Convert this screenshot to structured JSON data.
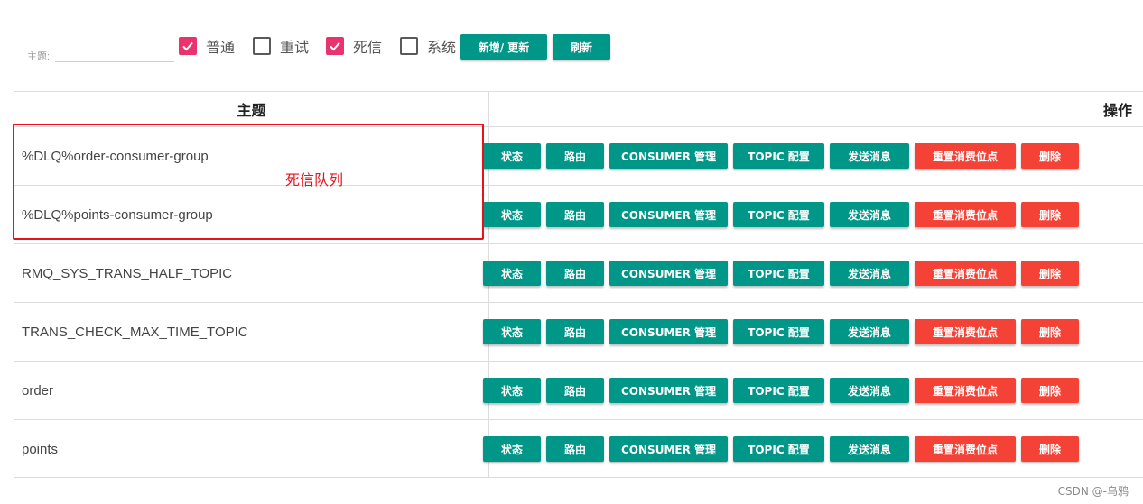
{
  "filter": {
    "label": "主题:",
    "input_value": "",
    "checkboxes": [
      {
        "label": "普通",
        "checked": true
      },
      {
        "label": "重试",
        "checked": false
      },
      {
        "label": "死信",
        "checked": true
      },
      {
        "label": "系统",
        "checked": false
      }
    ],
    "add_update_label": "新增/ 更新",
    "refresh_label": "刷新"
  },
  "table": {
    "header_topic": "主题",
    "header_ops": "操作",
    "rows": [
      {
        "name": "%DLQ%order-consumer-group"
      },
      {
        "name": "%DLQ%points-consumer-group"
      },
      {
        "name": "RMQ_SYS_TRANS_HALF_TOPIC"
      },
      {
        "name": "TRANS_CHECK_MAX_TIME_TOPIC"
      },
      {
        "name": "order"
      },
      {
        "name": "points"
      }
    ],
    "actions": {
      "status": "状态",
      "route": "路由",
      "consumer_manage": "CONSUMER 管理",
      "topic_config": "TOPIC 配置",
      "send_message": "发送消息",
      "reset_offset": "重置消费位点",
      "delete": "删除"
    }
  },
  "annotation": {
    "label": "死信队列"
  },
  "watermark": "CSDN @-乌鸦",
  "colors": {
    "primary": "#009688",
    "danger": "#f44336",
    "checkbox": "#e8336f",
    "annotation": "#e8121b"
  }
}
